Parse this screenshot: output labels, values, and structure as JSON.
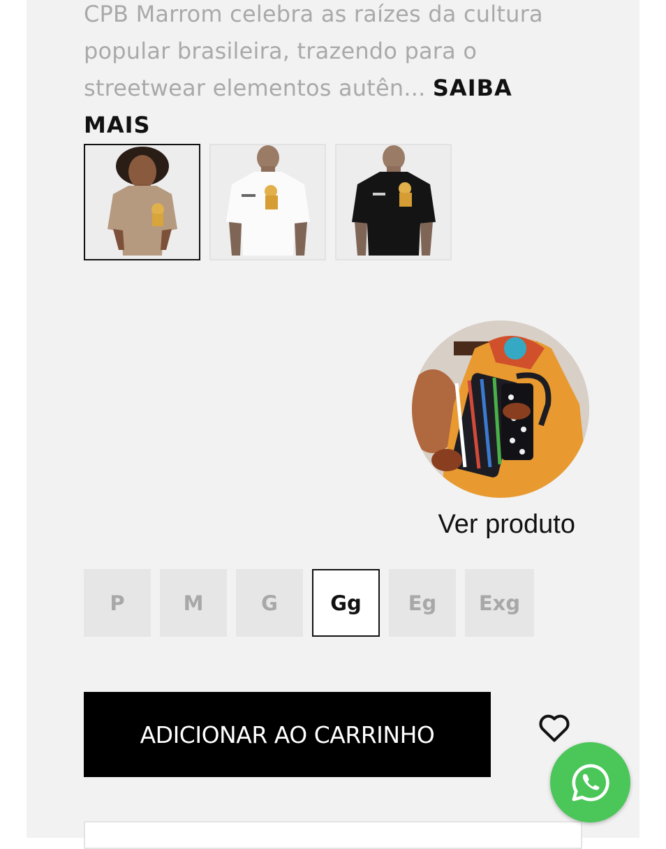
{
  "product": {
    "description": "CPB Marrom celebra as raízes da cultura popular brasileira, trazendo para o streetwear elementos autên...",
    "more_link": "SAIBA MAIS"
  },
  "gallery": {
    "thumbnails": [
      {
        "alt": "Camiseta marrom",
        "color": "#b59a80",
        "selected": true
      },
      {
        "alt": "Camiseta branca",
        "color": "#ffffff",
        "selected": false
      },
      {
        "alt": "Camiseta preta",
        "color": "#141414",
        "selected": false
      }
    ]
  },
  "related": {
    "link_label": "Ver produto"
  },
  "sizes": {
    "options": [
      "P",
      "M",
      "G",
      "Gg",
      "Eg",
      "Exg"
    ],
    "selected": "Gg"
  },
  "cart": {
    "button_label": "ADICIONAR AO CARRINHO"
  },
  "icons": {
    "wishlist": "heart-icon",
    "chat": "whatsapp-icon"
  },
  "colors": {
    "whatsapp": "#4bc659",
    "cart_button": "#000000",
    "panel_bg": "#f2f2f2"
  }
}
